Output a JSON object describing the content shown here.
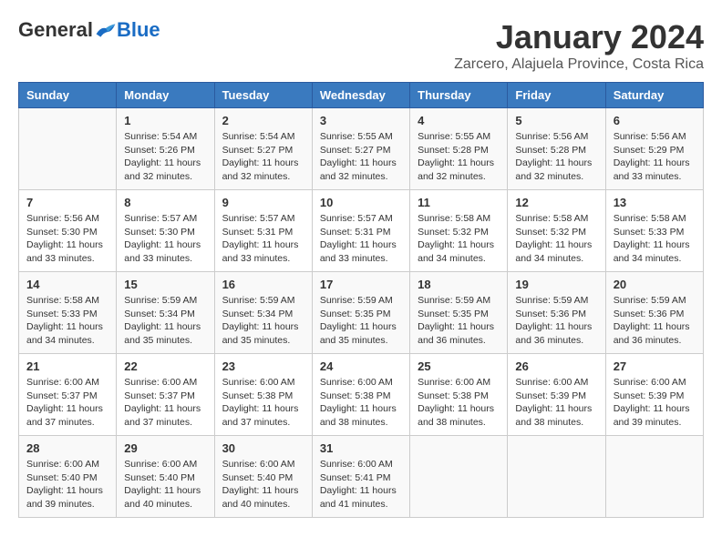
{
  "header": {
    "logo_general": "General",
    "logo_blue": "Blue",
    "month_title": "January 2024",
    "subtitle": "Zarcero, Alajuela Province, Costa Rica"
  },
  "days_of_week": [
    "Sunday",
    "Monday",
    "Tuesday",
    "Wednesday",
    "Thursday",
    "Friday",
    "Saturday"
  ],
  "weeks": [
    [
      {
        "day": "",
        "info": ""
      },
      {
        "day": "1",
        "info": "Sunrise: 5:54 AM\nSunset: 5:26 PM\nDaylight: 11 hours\nand 32 minutes."
      },
      {
        "day": "2",
        "info": "Sunrise: 5:54 AM\nSunset: 5:27 PM\nDaylight: 11 hours\nand 32 minutes."
      },
      {
        "day": "3",
        "info": "Sunrise: 5:55 AM\nSunset: 5:27 PM\nDaylight: 11 hours\nand 32 minutes."
      },
      {
        "day": "4",
        "info": "Sunrise: 5:55 AM\nSunset: 5:28 PM\nDaylight: 11 hours\nand 32 minutes."
      },
      {
        "day": "5",
        "info": "Sunrise: 5:56 AM\nSunset: 5:28 PM\nDaylight: 11 hours\nand 32 minutes."
      },
      {
        "day": "6",
        "info": "Sunrise: 5:56 AM\nSunset: 5:29 PM\nDaylight: 11 hours\nand 33 minutes."
      }
    ],
    [
      {
        "day": "7",
        "info": "Sunrise: 5:56 AM\nSunset: 5:30 PM\nDaylight: 11 hours\nand 33 minutes."
      },
      {
        "day": "8",
        "info": "Sunrise: 5:57 AM\nSunset: 5:30 PM\nDaylight: 11 hours\nand 33 minutes."
      },
      {
        "day": "9",
        "info": "Sunrise: 5:57 AM\nSunset: 5:31 PM\nDaylight: 11 hours\nand 33 minutes."
      },
      {
        "day": "10",
        "info": "Sunrise: 5:57 AM\nSunset: 5:31 PM\nDaylight: 11 hours\nand 33 minutes."
      },
      {
        "day": "11",
        "info": "Sunrise: 5:58 AM\nSunset: 5:32 PM\nDaylight: 11 hours\nand 34 minutes."
      },
      {
        "day": "12",
        "info": "Sunrise: 5:58 AM\nSunset: 5:32 PM\nDaylight: 11 hours\nand 34 minutes."
      },
      {
        "day": "13",
        "info": "Sunrise: 5:58 AM\nSunset: 5:33 PM\nDaylight: 11 hours\nand 34 minutes."
      }
    ],
    [
      {
        "day": "14",
        "info": "Sunrise: 5:58 AM\nSunset: 5:33 PM\nDaylight: 11 hours\nand 34 minutes."
      },
      {
        "day": "15",
        "info": "Sunrise: 5:59 AM\nSunset: 5:34 PM\nDaylight: 11 hours\nand 35 minutes."
      },
      {
        "day": "16",
        "info": "Sunrise: 5:59 AM\nSunset: 5:34 PM\nDaylight: 11 hours\nand 35 minutes."
      },
      {
        "day": "17",
        "info": "Sunrise: 5:59 AM\nSunset: 5:35 PM\nDaylight: 11 hours\nand 35 minutes."
      },
      {
        "day": "18",
        "info": "Sunrise: 5:59 AM\nSunset: 5:35 PM\nDaylight: 11 hours\nand 36 minutes."
      },
      {
        "day": "19",
        "info": "Sunrise: 5:59 AM\nSunset: 5:36 PM\nDaylight: 11 hours\nand 36 minutes."
      },
      {
        "day": "20",
        "info": "Sunrise: 5:59 AM\nSunset: 5:36 PM\nDaylight: 11 hours\nand 36 minutes."
      }
    ],
    [
      {
        "day": "21",
        "info": "Sunrise: 6:00 AM\nSunset: 5:37 PM\nDaylight: 11 hours\nand 37 minutes."
      },
      {
        "day": "22",
        "info": "Sunrise: 6:00 AM\nSunset: 5:37 PM\nDaylight: 11 hours\nand 37 minutes."
      },
      {
        "day": "23",
        "info": "Sunrise: 6:00 AM\nSunset: 5:38 PM\nDaylight: 11 hours\nand 37 minutes."
      },
      {
        "day": "24",
        "info": "Sunrise: 6:00 AM\nSunset: 5:38 PM\nDaylight: 11 hours\nand 38 minutes."
      },
      {
        "day": "25",
        "info": "Sunrise: 6:00 AM\nSunset: 5:38 PM\nDaylight: 11 hours\nand 38 minutes."
      },
      {
        "day": "26",
        "info": "Sunrise: 6:00 AM\nSunset: 5:39 PM\nDaylight: 11 hours\nand 38 minutes."
      },
      {
        "day": "27",
        "info": "Sunrise: 6:00 AM\nSunset: 5:39 PM\nDaylight: 11 hours\nand 39 minutes."
      }
    ],
    [
      {
        "day": "28",
        "info": "Sunrise: 6:00 AM\nSunset: 5:40 PM\nDaylight: 11 hours\nand 39 minutes."
      },
      {
        "day": "29",
        "info": "Sunrise: 6:00 AM\nSunset: 5:40 PM\nDaylight: 11 hours\nand 40 minutes."
      },
      {
        "day": "30",
        "info": "Sunrise: 6:00 AM\nSunset: 5:40 PM\nDaylight: 11 hours\nand 40 minutes."
      },
      {
        "day": "31",
        "info": "Sunrise: 6:00 AM\nSunset: 5:41 PM\nDaylight: 11 hours\nand 41 minutes."
      },
      {
        "day": "",
        "info": ""
      },
      {
        "day": "",
        "info": ""
      },
      {
        "day": "",
        "info": ""
      }
    ]
  ]
}
